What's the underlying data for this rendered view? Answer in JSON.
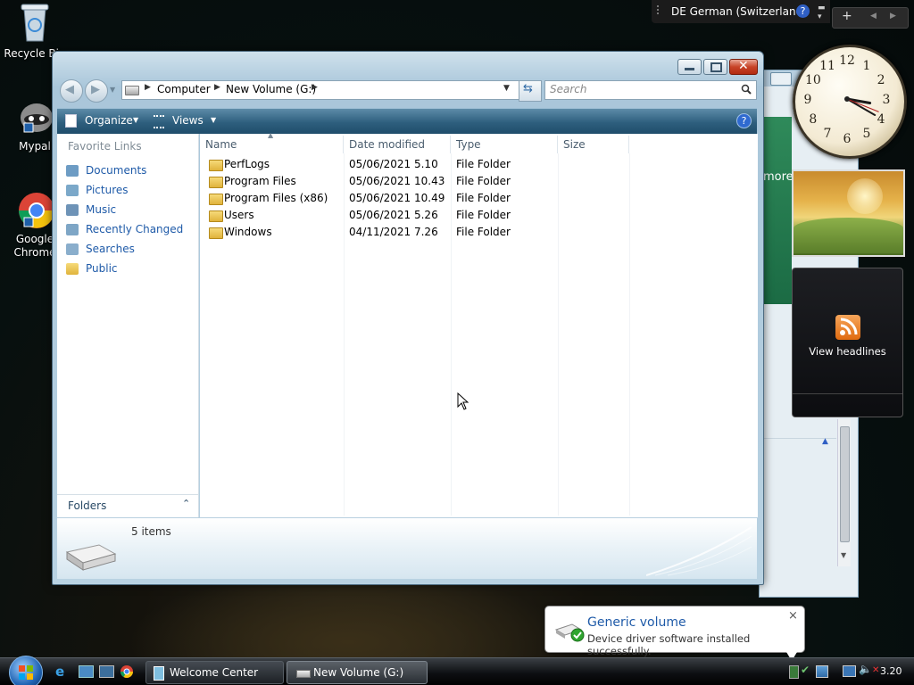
{
  "desktop": {
    "icons": [
      {
        "label": "Recycle Bin",
        "icon": "recycle-bin-icon"
      },
      {
        "label": "Mypal",
        "icon": "mypal-icon"
      },
      {
        "label": "Google Chrome",
        "icon": "chrome-icon"
      }
    ]
  },
  "langbar": {
    "label": "DE German (Switzerland)",
    "help": "?"
  },
  "window": {
    "address": {
      "parts": [
        "Computer",
        "New Volume (G:)"
      ]
    },
    "search_placeholder": "Search",
    "toolbar": {
      "organize": "Organize",
      "views": "Views",
      "help": "?"
    },
    "nav": {
      "heading": "Favorite Links",
      "items": [
        "Documents",
        "Pictures",
        "Music",
        "Recently Changed",
        "Searches",
        "Public"
      ],
      "folders_label": "Folders"
    },
    "columns": [
      "Name",
      "Date modified",
      "Type",
      "Size"
    ],
    "files": [
      {
        "name": "PerfLogs",
        "date": "05/06/2021 5.10",
        "type": "File Folder"
      },
      {
        "name": "Program Files",
        "date": "05/06/2021 10.43",
        "type": "File Folder"
      },
      {
        "name": "Program Files (x86)",
        "date": "05/06/2021 10.49",
        "type": "File Folder"
      },
      {
        "name": "Users",
        "date": "05/06/2021 5.26",
        "type": "File Folder"
      },
      {
        "name": "Windows",
        "date": "04/11/2021 7.26",
        "type": "File Folder"
      }
    ],
    "status": "5 items"
  },
  "background_window": {
    "partial_text": "more"
  },
  "gadgets": {
    "feed_label": "View headlines",
    "clock_numerals": [
      "12",
      "1",
      "2",
      "3",
      "4",
      "5",
      "6",
      "7",
      "8",
      "9",
      "10",
      "11"
    ]
  },
  "notification": {
    "title": "Generic volume",
    "message": "Device driver software installed successfully.",
    "close": "×"
  },
  "taskbar": {
    "buttons": [
      {
        "label": "Welcome Center"
      },
      {
        "label": "New Volume (G:)"
      }
    ],
    "clock": "3.20"
  },
  "colors": {
    "accent": "#1e5aa8",
    "toolbar": "#2e5f7e",
    "close": "#c84428"
  }
}
